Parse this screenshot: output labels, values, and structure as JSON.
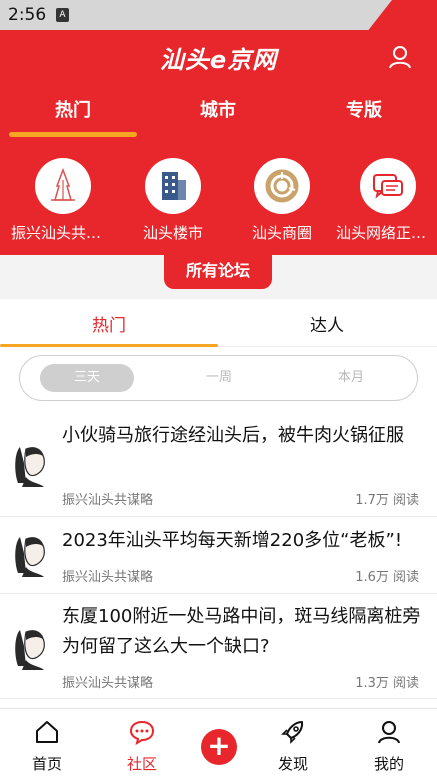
{
  "status_bar": {
    "time": "2:56",
    "notification_icon": "a-icon"
  },
  "header": {
    "brand": "汕头e京网",
    "user_icon": "user-icon",
    "tabs": [
      {
        "label": "热门",
        "active": true
      },
      {
        "label": "城市",
        "active": false
      },
      {
        "label": "专版",
        "active": false
      }
    ],
    "categories": [
      {
        "label": "振兴汕头共谋略",
        "icon": "tower-icon"
      },
      {
        "label": "汕头楼市",
        "icon": "building-icon"
      },
      {
        "label": "汕头商圈",
        "icon": "circle-chart-icon"
      },
      {
        "label": "汕头网络正能量",
        "icon": "chat-bubbles-icon"
      }
    ],
    "forum_label": "所有论坛"
  },
  "sub_tabs": [
    {
      "label": "热门",
      "active": true
    },
    {
      "label": "达人",
      "active": false
    }
  ],
  "time_filter": {
    "options": [
      "三天",
      "一周",
      "本月"
    ],
    "selected": "三天"
  },
  "posts": [
    {
      "title": "小伙骑马旅行途经汕头后，被牛肉火锅征服",
      "author": "振兴汕头共谋略",
      "views": "1.7万 阅读"
    },
    {
      "title": "2023年汕头平均每天新增220多位“老板”!",
      "author": "振兴汕头共谋略",
      "views": "1.6万 阅读"
    },
    {
      "title": "东厦100附近一处马路中间，斑马线隔离桩旁为何留了这么大一个缺口?",
      "author": "振兴汕头共谋略",
      "views": "1.3万 阅读"
    }
  ],
  "bottom_nav": [
    {
      "label": "首页",
      "icon": "home-icon",
      "active": false
    },
    {
      "label": "社区",
      "icon": "community-chat-icon",
      "active": true
    },
    {
      "label": "",
      "icon": "plus-icon",
      "active": false
    },
    {
      "label": "发现",
      "icon": "rocket-icon",
      "active": false
    },
    {
      "label": "我的",
      "icon": "profile-icon",
      "active": false
    }
  ],
  "colors": {
    "brand_red": "#e8272c",
    "accent_orange": "#f6a623",
    "muted_gray": "#777777"
  }
}
